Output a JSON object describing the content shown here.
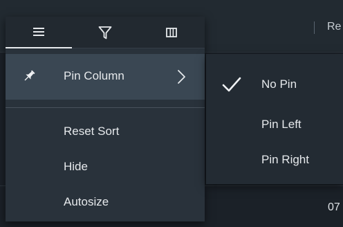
{
  "background_grid": {
    "header_text": "Re",
    "cell_text": "07"
  },
  "column_menu": {
    "tabs": [
      {
        "icon": "menu-icon",
        "active": true
      },
      {
        "icon": "filter-icon",
        "active": false
      },
      {
        "icon": "columns-icon",
        "active": false
      }
    ],
    "items": {
      "pin_column": {
        "label": "Pin Column",
        "icon": "pin-icon",
        "submenu_arrow": "chevron-right-icon"
      },
      "reset_sort": {
        "label": "Reset Sort"
      },
      "hide": {
        "label": "Hide"
      },
      "autosize": {
        "label": "Autosize"
      }
    }
  },
  "pin_submenu": {
    "options": [
      {
        "label": "No Pin",
        "checked": true
      },
      {
        "label": "Pin Left",
        "checked": false
      },
      {
        "label": "Pin Right",
        "checked": false
      }
    ]
  },
  "colors": {
    "menu_bg": "#29323b",
    "tab_bar_bg": "#222930",
    "highlight_bg": "#3a4753",
    "submenu_bg": "#232b33",
    "text": "#e6e9ec"
  }
}
